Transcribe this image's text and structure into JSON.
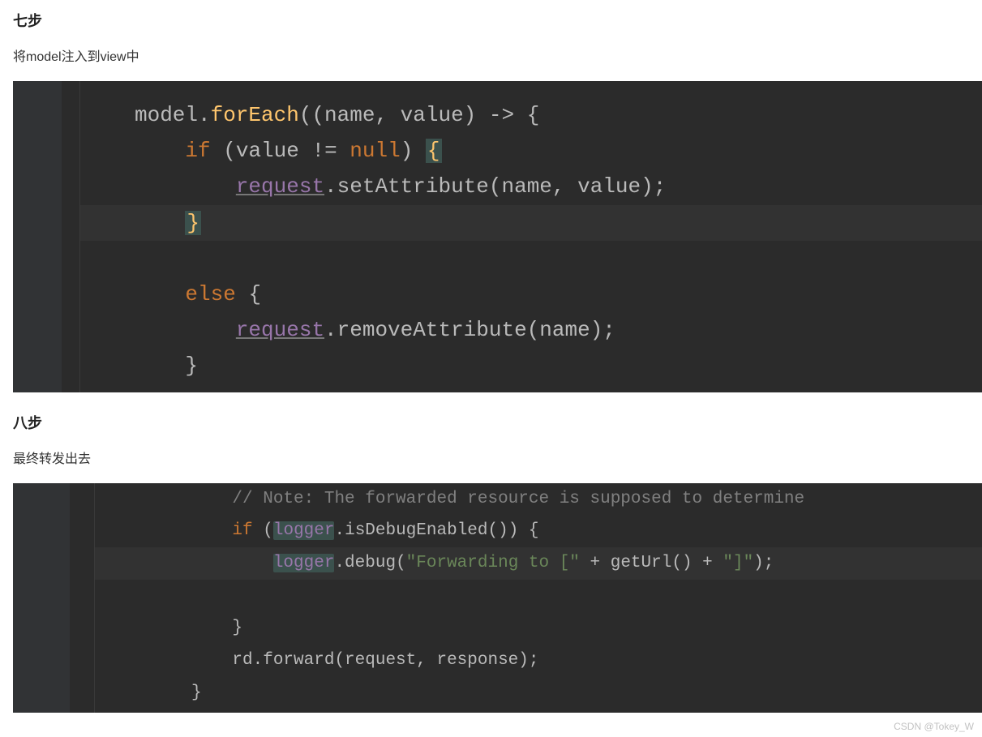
{
  "section1": {
    "heading": "七步",
    "description": "将model注入到view中",
    "code": {
      "l1_a": "model.",
      "l1_b": "forEach",
      "l1_c": "((name, value) -> {",
      "l2_a": "if",
      "l2_b": " (value != ",
      "l2_c": "null",
      "l2_d": ") ",
      "l2_e": "{",
      "l3_a": "request",
      "l3_b": ".setAttribute(name, value);",
      "l4": "}",
      "l5_a": "else",
      "l5_b": " {",
      "l6_a": "request",
      "l6_b": ".removeAttribute(name);",
      "l7": "}"
    }
  },
  "section2": {
    "heading": "八步",
    "description": "最终转发出去",
    "code": {
      "l0": "// Note: The forwarded resource is supposed to determine",
      "l1_a": "if",
      "l1_b": " (",
      "l1_c": "logger",
      "l1_d": ".isDebugEnabled()) {",
      "l2_a": "logger",
      "l2_b": ".debug(",
      "l2_c": "\"Forwarding to [\"",
      "l2_d": " + getUrl() + ",
      "l2_e": "\"]\"",
      "l2_f": ");",
      "l3": "}",
      "l4": "rd.forward(request, response);",
      "l5": "}"
    }
  },
  "watermark": "CSDN @Tokey_W"
}
